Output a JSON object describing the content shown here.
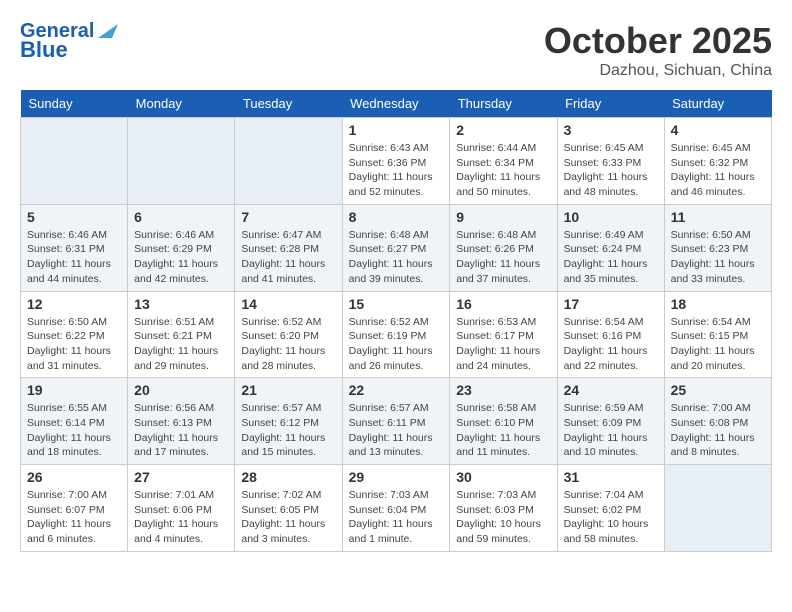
{
  "header": {
    "logo_line1": "General",
    "logo_line2": "Blue",
    "month": "October 2025",
    "location": "Dazhou, Sichuan, China"
  },
  "weekdays": [
    "Sunday",
    "Monday",
    "Tuesday",
    "Wednesday",
    "Thursday",
    "Friday",
    "Saturday"
  ],
  "weeks": [
    [
      {
        "day": "",
        "info": ""
      },
      {
        "day": "",
        "info": ""
      },
      {
        "day": "",
        "info": ""
      },
      {
        "day": "1",
        "info": "Sunrise: 6:43 AM\nSunset: 6:36 PM\nDaylight: 11 hours\nand 52 minutes."
      },
      {
        "day": "2",
        "info": "Sunrise: 6:44 AM\nSunset: 6:34 PM\nDaylight: 11 hours\nand 50 minutes."
      },
      {
        "day": "3",
        "info": "Sunrise: 6:45 AM\nSunset: 6:33 PM\nDaylight: 11 hours\nand 48 minutes."
      },
      {
        "day": "4",
        "info": "Sunrise: 6:45 AM\nSunset: 6:32 PM\nDaylight: 11 hours\nand 46 minutes."
      }
    ],
    [
      {
        "day": "5",
        "info": "Sunrise: 6:46 AM\nSunset: 6:31 PM\nDaylight: 11 hours\nand 44 minutes."
      },
      {
        "day": "6",
        "info": "Sunrise: 6:46 AM\nSunset: 6:29 PM\nDaylight: 11 hours\nand 42 minutes."
      },
      {
        "day": "7",
        "info": "Sunrise: 6:47 AM\nSunset: 6:28 PM\nDaylight: 11 hours\nand 41 minutes."
      },
      {
        "day": "8",
        "info": "Sunrise: 6:48 AM\nSunset: 6:27 PM\nDaylight: 11 hours\nand 39 minutes."
      },
      {
        "day": "9",
        "info": "Sunrise: 6:48 AM\nSunset: 6:26 PM\nDaylight: 11 hours\nand 37 minutes."
      },
      {
        "day": "10",
        "info": "Sunrise: 6:49 AM\nSunset: 6:24 PM\nDaylight: 11 hours\nand 35 minutes."
      },
      {
        "day": "11",
        "info": "Sunrise: 6:50 AM\nSunset: 6:23 PM\nDaylight: 11 hours\nand 33 minutes."
      }
    ],
    [
      {
        "day": "12",
        "info": "Sunrise: 6:50 AM\nSunset: 6:22 PM\nDaylight: 11 hours\nand 31 minutes."
      },
      {
        "day": "13",
        "info": "Sunrise: 6:51 AM\nSunset: 6:21 PM\nDaylight: 11 hours\nand 29 minutes."
      },
      {
        "day": "14",
        "info": "Sunrise: 6:52 AM\nSunset: 6:20 PM\nDaylight: 11 hours\nand 28 minutes."
      },
      {
        "day": "15",
        "info": "Sunrise: 6:52 AM\nSunset: 6:19 PM\nDaylight: 11 hours\nand 26 minutes."
      },
      {
        "day": "16",
        "info": "Sunrise: 6:53 AM\nSunset: 6:17 PM\nDaylight: 11 hours\nand 24 minutes."
      },
      {
        "day": "17",
        "info": "Sunrise: 6:54 AM\nSunset: 6:16 PM\nDaylight: 11 hours\nand 22 minutes."
      },
      {
        "day": "18",
        "info": "Sunrise: 6:54 AM\nSunset: 6:15 PM\nDaylight: 11 hours\nand 20 minutes."
      }
    ],
    [
      {
        "day": "19",
        "info": "Sunrise: 6:55 AM\nSunset: 6:14 PM\nDaylight: 11 hours\nand 18 minutes."
      },
      {
        "day": "20",
        "info": "Sunrise: 6:56 AM\nSunset: 6:13 PM\nDaylight: 11 hours\nand 17 minutes."
      },
      {
        "day": "21",
        "info": "Sunrise: 6:57 AM\nSunset: 6:12 PM\nDaylight: 11 hours\nand 15 minutes."
      },
      {
        "day": "22",
        "info": "Sunrise: 6:57 AM\nSunset: 6:11 PM\nDaylight: 11 hours\nand 13 minutes."
      },
      {
        "day": "23",
        "info": "Sunrise: 6:58 AM\nSunset: 6:10 PM\nDaylight: 11 hours\nand 11 minutes."
      },
      {
        "day": "24",
        "info": "Sunrise: 6:59 AM\nSunset: 6:09 PM\nDaylight: 11 hours\nand 10 minutes."
      },
      {
        "day": "25",
        "info": "Sunrise: 7:00 AM\nSunset: 6:08 PM\nDaylight: 11 hours\nand 8 minutes."
      }
    ],
    [
      {
        "day": "26",
        "info": "Sunrise: 7:00 AM\nSunset: 6:07 PM\nDaylight: 11 hours\nand 6 minutes."
      },
      {
        "day": "27",
        "info": "Sunrise: 7:01 AM\nSunset: 6:06 PM\nDaylight: 11 hours\nand 4 minutes."
      },
      {
        "day": "28",
        "info": "Sunrise: 7:02 AM\nSunset: 6:05 PM\nDaylight: 11 hours\nand 3 minutes."
      },
      {
        "day": "29",
        "info": "Sunrise: 7:03 AM\nSunset: 6:04 PM\nDaylight: 11 hours\nand 1 minute."
      },
      {
        "day": "30",
        "info": "Sunrise: 7:03 AM\nSunset: 6:03 PM\nDaylight: 10 hours\nand 59 minutes."
      },
      {
        "day": "31",
        "info": "Sunrise: 7:04 AM\nSunset: 6:02 PM\nDaylight: 10 hours\nand 58 minutes."
      },
      {
        "day": "",
        "info": ""
      }
    ]
  ]
}
